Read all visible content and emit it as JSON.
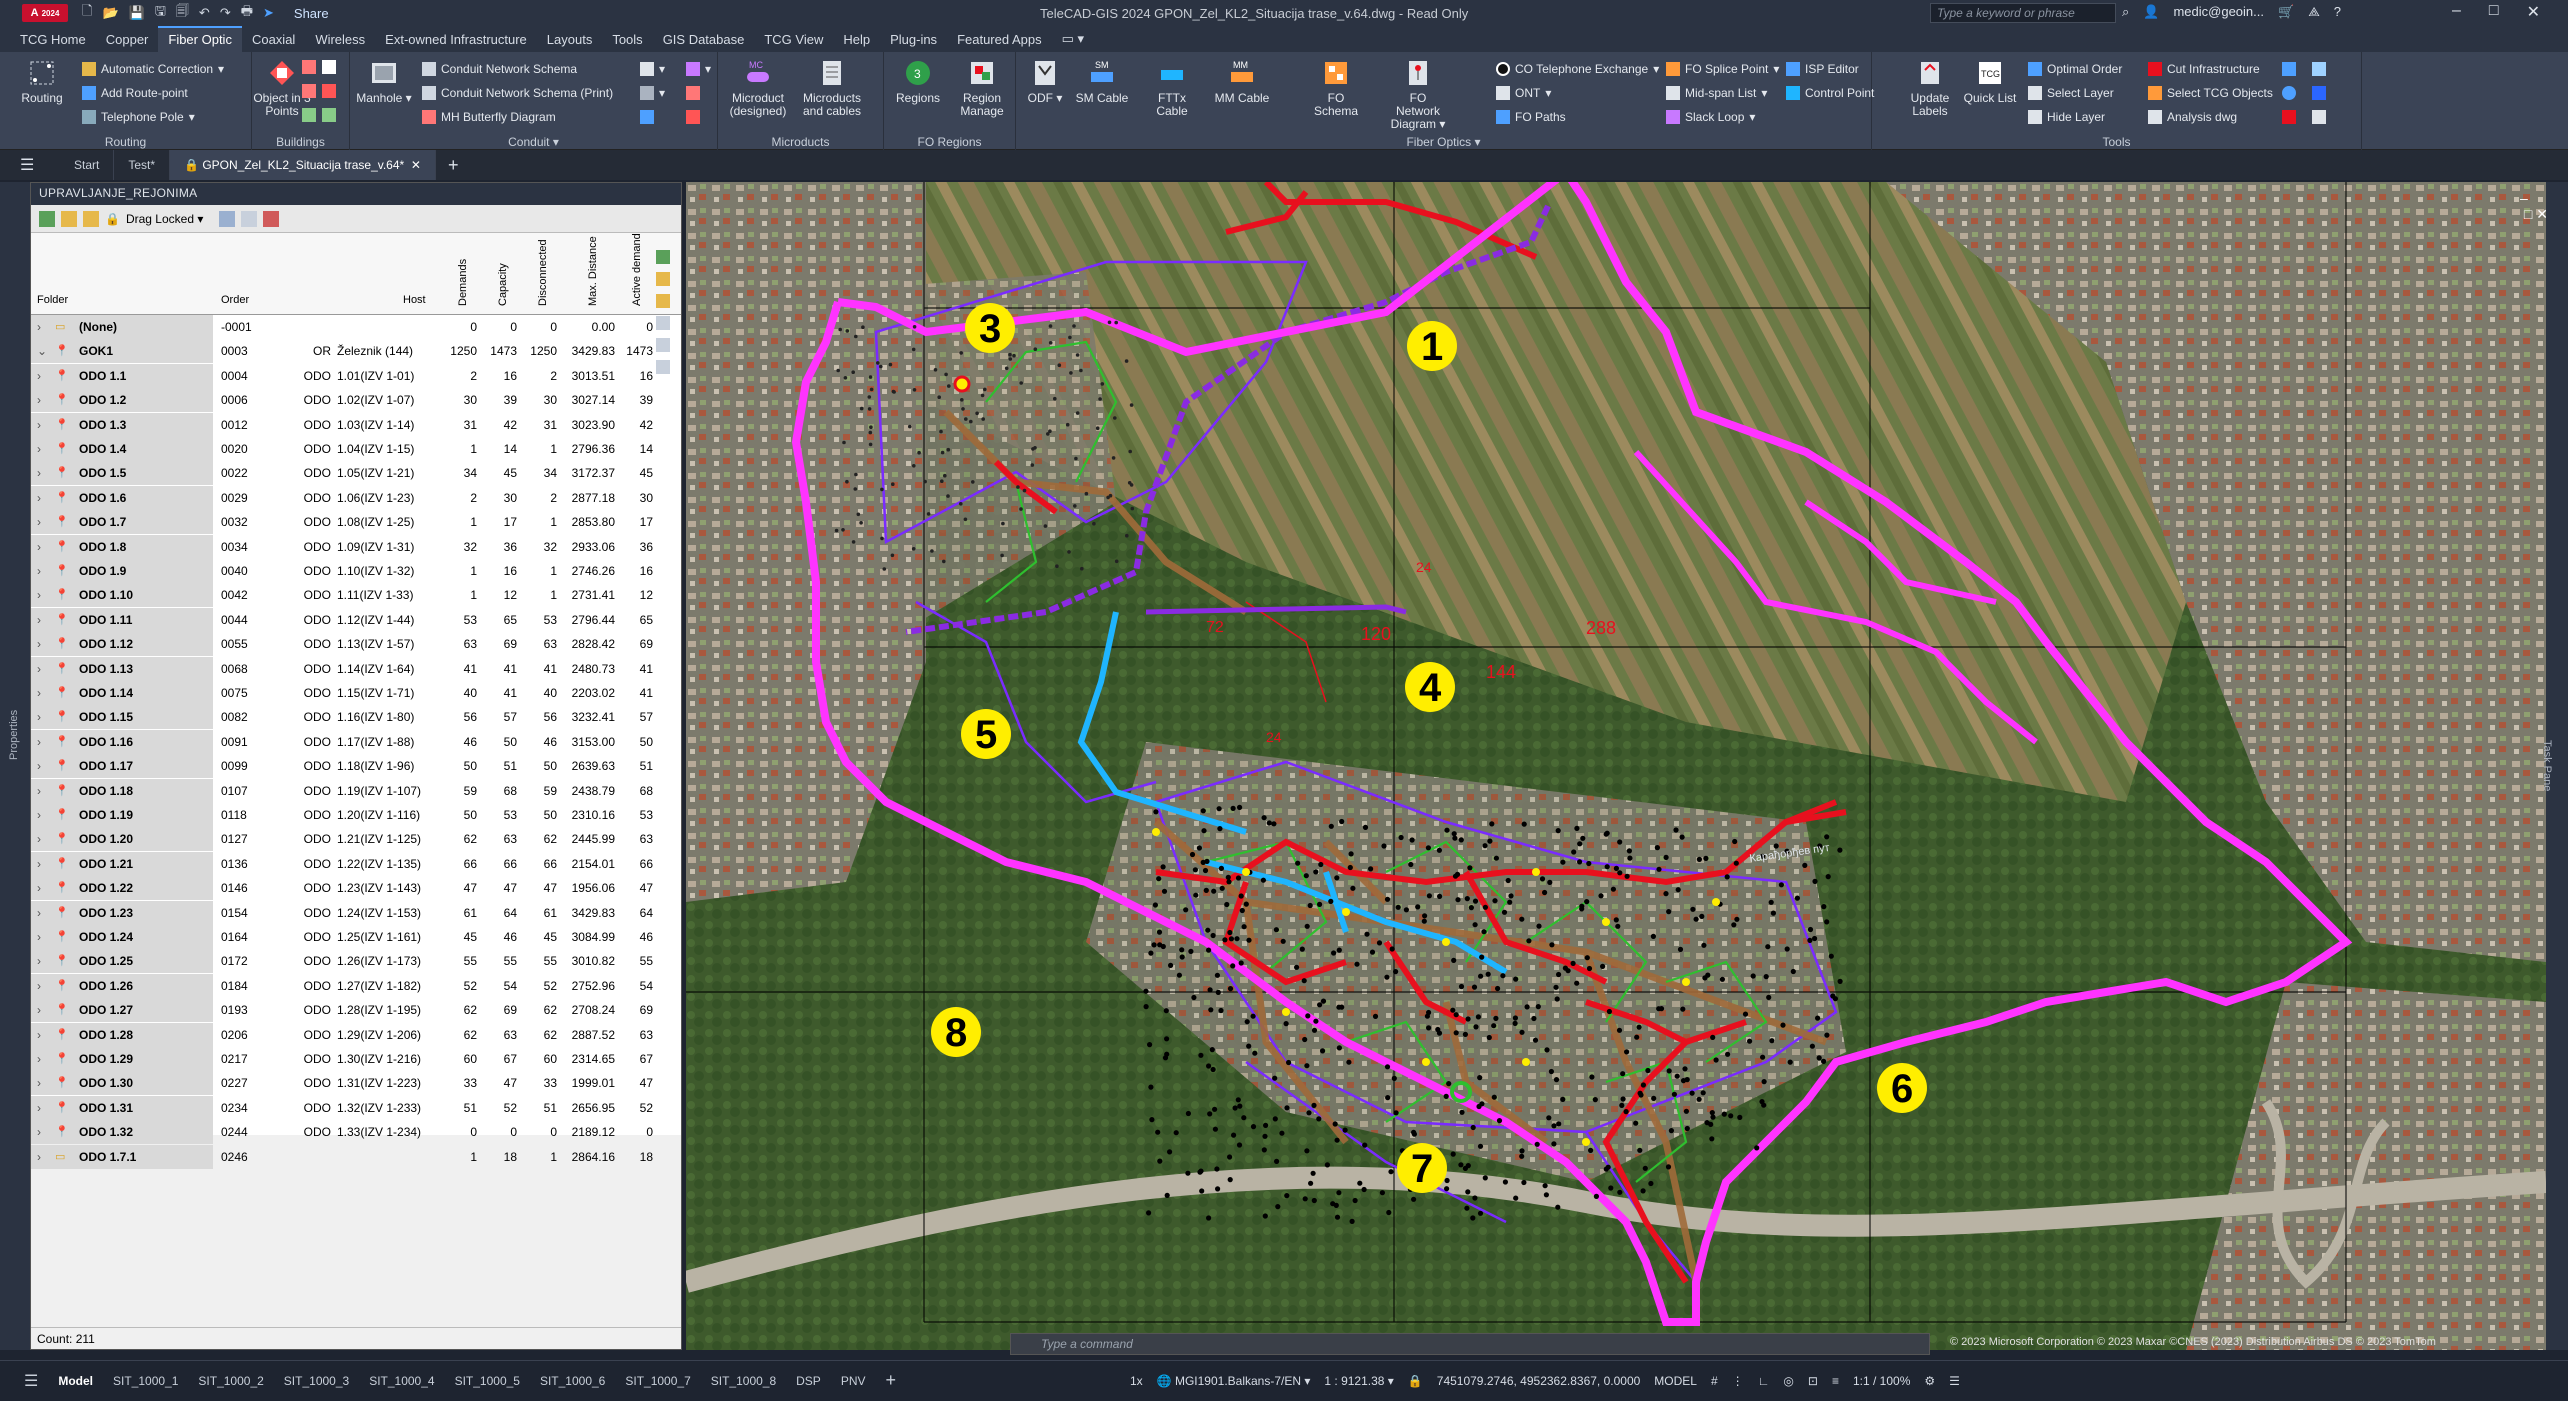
{
  "titlebar": {
    "app_logo": "A",
    "app_logo_sub": "2024",
    "share": "Share",
    "title": "TeleCAD-GIS 2024   GPON_Zel_KL2_Situacija trase_v.64.dwg - Read Only",
    "search_placeholder": "Type a keyword or phrase",
    "user": "medic@geoin...",
    "win_min": "–",
    "win_max": "□",
    "win_close": "✕"
  },
  "menu": [
    "TCG Home",
    "Copper",
    "Fiber Optic",
    "Coaxial",
    "Wireless",
    "Ext-owned Infrastructure",
    "Layouts",
    "Tools",
    "GIS Database",
    "TCG View",
    "Help",
    "Plug-ins",
    "Featured Apps"
  ],
  "menu_extra": "▭ ▾",
  "ribbon": {
    "routing": {
      "title": "Routing",
      "large": "Routing",
      "auto": "Automatic Correction",
      "add": "Add Route-point",
      "pole": "Telephone Pole"
    },
    "buildings": {
      "title": "Buildings",
      "obj": "Object in 3 Points"
    },
    "conduit": {
      "title": "Conduit",
      "manhole": "Manhole",
      "schema": "Conduit Network Schema",
      "schema_print": "Conduit Network Schema (Print)",
      "mh": "MH Butterfly Diagram"
    },
    "microducts": {
      "title": "Microducts",
      "mc": "MC",
      "designed": "Microduct (designed)",
      "mc_cables": "Microducts and cables"
    },
    "regions": {
      "title": "FO Regions",
      "regions": "Regions",
      "manage": "Region Manage"
    },
    "fiberoptics": {
      "title": "Fiber Optics",
      "odf": "ODF",
      "sm": "SM Cable",
      "ftth": "FTTx Cable",
      "mm": "MM Cable",
      "schema": "FO Schema",
      "network": "FO Network Diagram",
      "co": "CO Telephone Exchange",
      "ont": "ONT",
      "paths": "FO Paths",
      "splice": "FO Splice Point",
      "midspan": "Mid-span List",
      "slack": "Slack Loop",
      "isp": "ISP Editor",
      "control": "Control Point"
    },
    "tools": {
      "title": "Tools",
      "update": "Update Labels",
      "quick": "Quick List",
      "tcg": "TCG",
      "optimal": "Optimal Order",
      "select_layer": "Select Layer",
      "hide_layer": "Hide Layer",
      "cut": "Cut Infrastructure",
      "select_tcg": "Select TCG Objects",
      "analysis": "Analysis dwg"
    }
  },
  "filetabs": {
    "start": "Start",
    "test": "Test*",
    "doc": "GPON_Zel_KL2_Situacija trase_v.64*"
  },
  "sidebar": {
    "properties": "Properties",
    "task_pane": "Task Pane"
  },
  "panel": {
    "title": "UPRAVLJANJE_REJONIMA",
    "drag": "Drag Locked",
    "headers": {
      "folder": "Folder",
      "order": "Order",
      "host": "Host",
      "demands": "Demands",
      "capacity": "Capacity",
      "disconnected": "Disconnected",
      "max": "Max. Distance",
      "active": "Active demand"
    },
    "rows": [
      {
        "exp": "›",
        "folder": "(None)",
        "order": "-0001",
        "code": "",
        "host": "",
        "d": "0",
        "c": "0",
        "x": "0",
        "m": "0.00",
        "a": "0"
      },
      {
        "exp": "⌄",
        "folder": "GOK1",
        "order": "0003",
        "code": "OR",
        "host": "Železnik (144)",
        "d": "1250",
        "c": "1473",
        "x": "1250",
        "m": "3429.83",
        "a": "1473"
      },
      {
        "exp": "›",
        "folder": "ODO 1.1",
        "order": "0004",
        "code": "ODO",
        "host": "1.01(IZV 1-01)",
        "d": "2",
        "c": "16",
        "x": "2",
        "m": "3013.51",
        "a": "16"
      },
      {
        "exp": "›",
        "folder": "ODO 1.2",
        "order": "0006",
        "code": "ODO",
        "host": "1.02(IZV 1-07)",
        "d": "30",
        "c": "39",
        "x": "30",
        "m": "3027.14",
        "a": "39"
      },
      {
        "exp": "›",
        "folder": "ODO 1.3",
        "order": "0012",
        "code": "ODO",
        "host": "1.03(IZV 1-14)",
        "d": "31",
        "c": "42",
        "x": "31",
        "m": "3023.90",
        "a": "42"
      },
      {
        "exp": "›",
        "folder": "ODO 1.4",
        "order": "0020",
        "code": "ODO",
        "host": "1.04(IZV 1-15)",
        "d": "1",
        "c": "14",
        "x": "1",
        "m": "2796.36",
        "a": "14"
      },
      {
        "exp": "›",
        "folder": "ODO 1.5",
        "order": "0022",
        "code": "ODO",
        "host": "1.05(IZV 1-21)",
        "d": "34",
        "c": "45",
        "x": "34",
        "m": "3172.37",
        "a": "45"
      },
      {
        "exp": "›",
        "folder": "ODO 1.6",
        "order": "0029",
        "code": "ODO",
        "host": "1.06(IZV 1-23)",
        "d": "2",
        "c": "30",
        "x": "2",
        "m": "2877.18",
        "a": "30"
      },
      {
        "exp": "›",
        "folder": "ODO 1.7",
        "order": "0032",
        "code": "ODO",
        "host": "1.08(IZV 1-25)",
        "d": "1",
        "c": "17",
        "x": "1",
        "m": "2853.80",
        "a": "17"
      },
      {
        "exp": "›",
        "folder": "ODO 1.8",
        "order": "0034",
        "code": "ODO",
        "host": "1.09(IZV 1-31)",
        "d": "32",
        "c": "36",
        "x": "32",
        "m": "2933.06",
        "a": "36"
      },
      {
        "exp": "›",
        "folder": "ODO 1.9",
        "order": "0040",
        "code": "ODO",
        "host": "1.10(IZV 1-32)",
        "d": "1",
        "c": "16",
        "x": "1",
        "m": "2746.26",
        "a": "16"
      },
      {
        "exp": "›",
        "folder": "ODO 1.10",
        "order": "0042",
        "code": "ODO",
        "host": "1.11(IZV 1-33)",
        "d": "1",
        "c": "12",
        "x": "1",
        "m": "2731.41",
        "a": "12"
      },
      {
        "exp": "›",
        "folder": "ODO 1.11",
        "order": "0044",
        "code": "ODO",
        "host": "1.12(IZV 1-44)",
        "d": "53",
        "c": "65",
        "x": "53",
        "m": "2796.44",
        "a": "65"
      },
      {
        "exp": "›",
        "folder": "ODO 1.12",
        "order": "0055",
        "code": "ODO",
        "host": "1.13(IZV 1-57)",
        "d": "63",
        "c": "69",
        "x": "63",
        "m": "2828.42",
        "a": "69"
      },
      {
        "exp": "›",
        "folder": "ODO 1.13",
        "order": "0068",
        "code": "ODO",
        "host": "1.14(IZV 1-64)",
        "d": "41",
        "c": "41",
        "x": "41",
        "m": "2480.73",
        "a": "41"
      },
      {
        "exp": "›",
        "folder": "ODO 1.14",
        "order": "0075",
        "code": "ODO",
        "host": "1.15(IZV 1-71)",
        "d": "40",
        "c": "41",
        "x": "40",
        "m": "2203.02",
        "a": "41"
      },
      {
        "exp": "›",
        "folder": "ODO 1.15",
        "order": "0082",
        "code": "ODO",
        "host": "1.16(IZV 1-80)",
        "d": "56",
        "c": "57",
        "x": "56",
        "m": "3232.41",
        "a": "57"
      },
      {
        "exp": "›",
        "folder": "ODO 1.16",
        "order": "0091",
        "code": "ODO",
        "host": "1.17(IZV 1-88)",
        "d": "46",
        "c": "50",
        "x": "46",
        "m": "3153.00",
        "a": "50"
      },
      {
        "exp": "›",
        "folder": "ODO 1.17",
        "order": "0099",
        "code": "ODO",
        "host": "1.18(IZV 1-96)",
        "d": "50",
        "c": "51",
        "x": "50",
        "m": "2639.63",
        "a": "51"
      },
      {
        "exp": "›",
        "folder": "ODO 1.18",
        "order": "0107",
        "code": "ODO",
        "host": "1.19(IZV 1-107)",
        "d": "59",
        "c": "68",
        "x": "59",
        "m": "2438.79",
        "a": "68"
      },
      {
        "exp": "›",
        "folder": "ODO 1.19",
        "order": "0118",
        "code": "ODO",
        "host": "1.20(IZV 1-116)",
        "d": "50",
        "c": "53",
        "x": "50",
        "m": "2310.16",
        "a": "53"
      },
      {
        "exp": "›",
        "folder": "ODO 1.20",
        "order": "0127",
        "code": "ODO",
        "host": "1.21(IZV 1-125)",
        "d": "62",
        "c": "63",
        "x": "62",
        "m": "2445.99",
        "a": "63"
      },
      {
        "exp": "›",
        "folder": "ODO 1.21",
        "order": "0136",
        "code": "ODO",
        "host": "1.22(IZV 1-135)",
        "d": "66",
        "c": "66",
        "x": "66",
        "m": "2154.01",
        "a": "66"
      },
      {
        "exp": "›",
        "folder": "ODO 1.22",
        "order": "0146",
        "code": "ODO",
        "host": "1.23(IZV 1-143)",
        "d": "47",
        "c": "47",
        "x": "47",
        "m": "1956.06",
        "a": "47"
      },
      {
        "exp": "›",
        "folder": "ODO 1.23",
        "order": "0154",
        "code": "ODO",
        "host": "1.24(IZV 1-153)",
        "d": "61",
        "c": "64",
        "x": "61",
        "m": "3429.83",
        "a": "64"
      },
      {
        "exp": "›",
        "folder": "ODO 1.24",
        "order": "0164",
        "code": "ODO",
        "host": "1.25(IZV 1-161)",
        "d": "45",
        "c": "46",
        "x": "45",
        "m": "3084.99",
        "a": "46"
      },
      {
        "exp": "›",
        "folder": "ODO 1.25",
        "order": "0172",
        "code": "ODO",
        "host": "1.26(IZV 1-173)",
        "d": "55",
        "c": "55",
        "x": "55",
        "m": "3010.82",
        "a": "55"
      },
      {
        "exp": "›",
        "folder": "ODO 1.26",
        "order": "0184",
        "code": "ODO",
        "host": "1.27(IZV 1-182)",
        "d": "52",
        "c": "54",
        "x": "52",
        "m": "2752.96",
        "a": "54"
      },
      {
        "exp": "›",
        "folder": "ODO 1.27",
        "order": "0193",
        "code": "ODO",
        "host": "1.28(IZV 1-195)",
        "d": "62",
        "c": "69",
        "x": "62",
        "m": "2708.24",
        "a": "69"
      },
      {
        "exp": "›",
        "folder": "ODO 1.28",
        "order": "0206",
        "code": "ODO",
        "host": "1.29(IZV 1-206)",
        "d": "62",
        "c": "63",
        "x": "62",
        "m": "2887.52",
        "a": "63"
      },
      {
        "exp": "›",
        "folder": "ODO 1.29",
        "order": "0217",
        "code": "ODO",
        "host": "1.30(IZV 1-216)",
        "d": "60",
        "c": "67",
        "x": "60",
        "m": "2314.65",
        "a": "67"
      },
      {
        "exp": "›",
        "folder": "ODO 1.30",
        "order": "0227",
        "code": "ODO",
        "host": "1.31(IZV 1-223)",
        "d": "33",
        "c": "47",
        "x": "33",
        "m": "1999.01",
        "a": "47"
      },
      {
        "exp": "›",
        "folder": "ODO 1.31",
        "order": "0234",
        "code": "ODO",
        "host": "1.32(IZV 1-233)",
        "d": "51",
        "c": "52",
        "x": "51",
        "m": "2656.95",
        "a": "52"
      },
      {
        "exp": "›",
        "folder": "ODO 1.32",
        "order": "0244",
        "code": "ODO",
        "host": "1.33(IZV 1-234)",
        "d": "0",
        "c": "0",
        "x": "0",
        "m": "2189.12",
        "a": "0"
      },
      {
        "exp": "›",
        "folder": "ODO 1.7.1",
        "order": "0246",
        "code": "",
        "host": "",
        "d": "1",
        "c": "18",
        "x": "1",
        "m": "2864.16",
        "a": "18"
      }
    ],
    "count": "Count: 211"
  },
  "map": {
    "regions": [
      "1",
      "2",
      "3",
      "4",
      "5",
      "6",
      "7",
      "8"
    ],
    "red_labels": [
      "120",
      "288",
      "144",
      "24",
      "72",
      "24"
    ],
    "road_label": "Карађорђев пут",
    "copyright": "© 2023 Microsoft Corporation © 2023 Maxar ©CNES (2023) Distribution Airbus DS © 2023 TomTom",
    "command_placeholder": "Type a command"
  },
  "status": {
    "layouts": [
      "Model",
      "SIT_1000_1",
      "SIT_1000_2",
      "SIT_1000_3",
      "SIT_1000_4",
      "SIT_1000_5",
      "SIT_1000_6",
      "SIT_1000_7",
      "SIT_1000_8",
      "DSP",
      "PNV"
    ],
    "coords": "7451079.2746, 4952362.8367, 0.0000",
    "mode": "MODEL",
    "crs": "MGI1901.Balkans-7/EN",
    "scale": "1 : 9121.38",
    "anno": "1:1 / 100%",
    "zoom": "1x"
  },
  "colors": {
    "accent": "#4ea0ff",
    "region": "#ff33ff",
    "feeder": "#e8101e",
    "conduit": "#8a2be2",
    "trench": "#a06a3a",
    "distribution": "#2fbf2f",
    "cyan": "#1fb5ff",
    "marker": "#ffee00"
  }
}
